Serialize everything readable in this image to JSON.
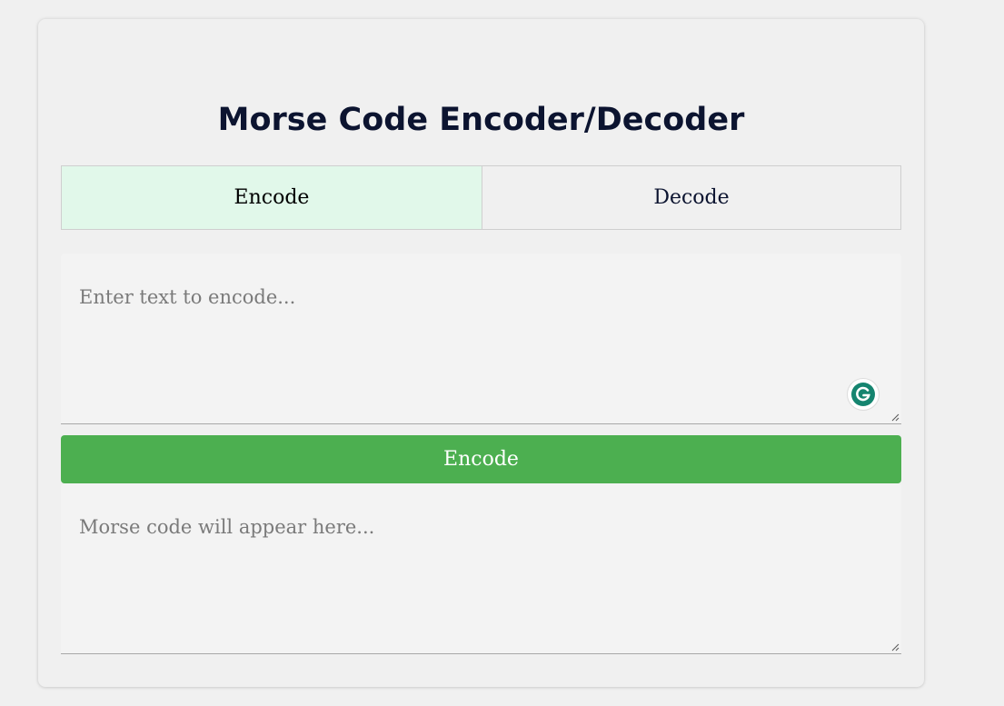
{
  "app": {
    "title": "Morse Code Encoder/Decoder"
  },
  "tabs": [
    {
      "label": "Encode",
      "active": true
    },
    {
      "label": "Decode",
      "active": false
    }
  ],
  "input": {
    "value": "",
    "placeholder": "Enter text to encode..."
  },
  "action": {
    "label": "Encode"
  },
  "output": {
    "value": "",
    "placeholder": "Morse code will appear here..."
  },
  "icons": {
    "grammarly": "grammarly-icon",
    "resize": "resize-handle-icon"
  },
  "colors": {
    "accent": "#4caf50",
    "active_tab": "#e1f8ea",
    "grammarly": "#15846f",
    "title": "#0c1430"
  }
}
